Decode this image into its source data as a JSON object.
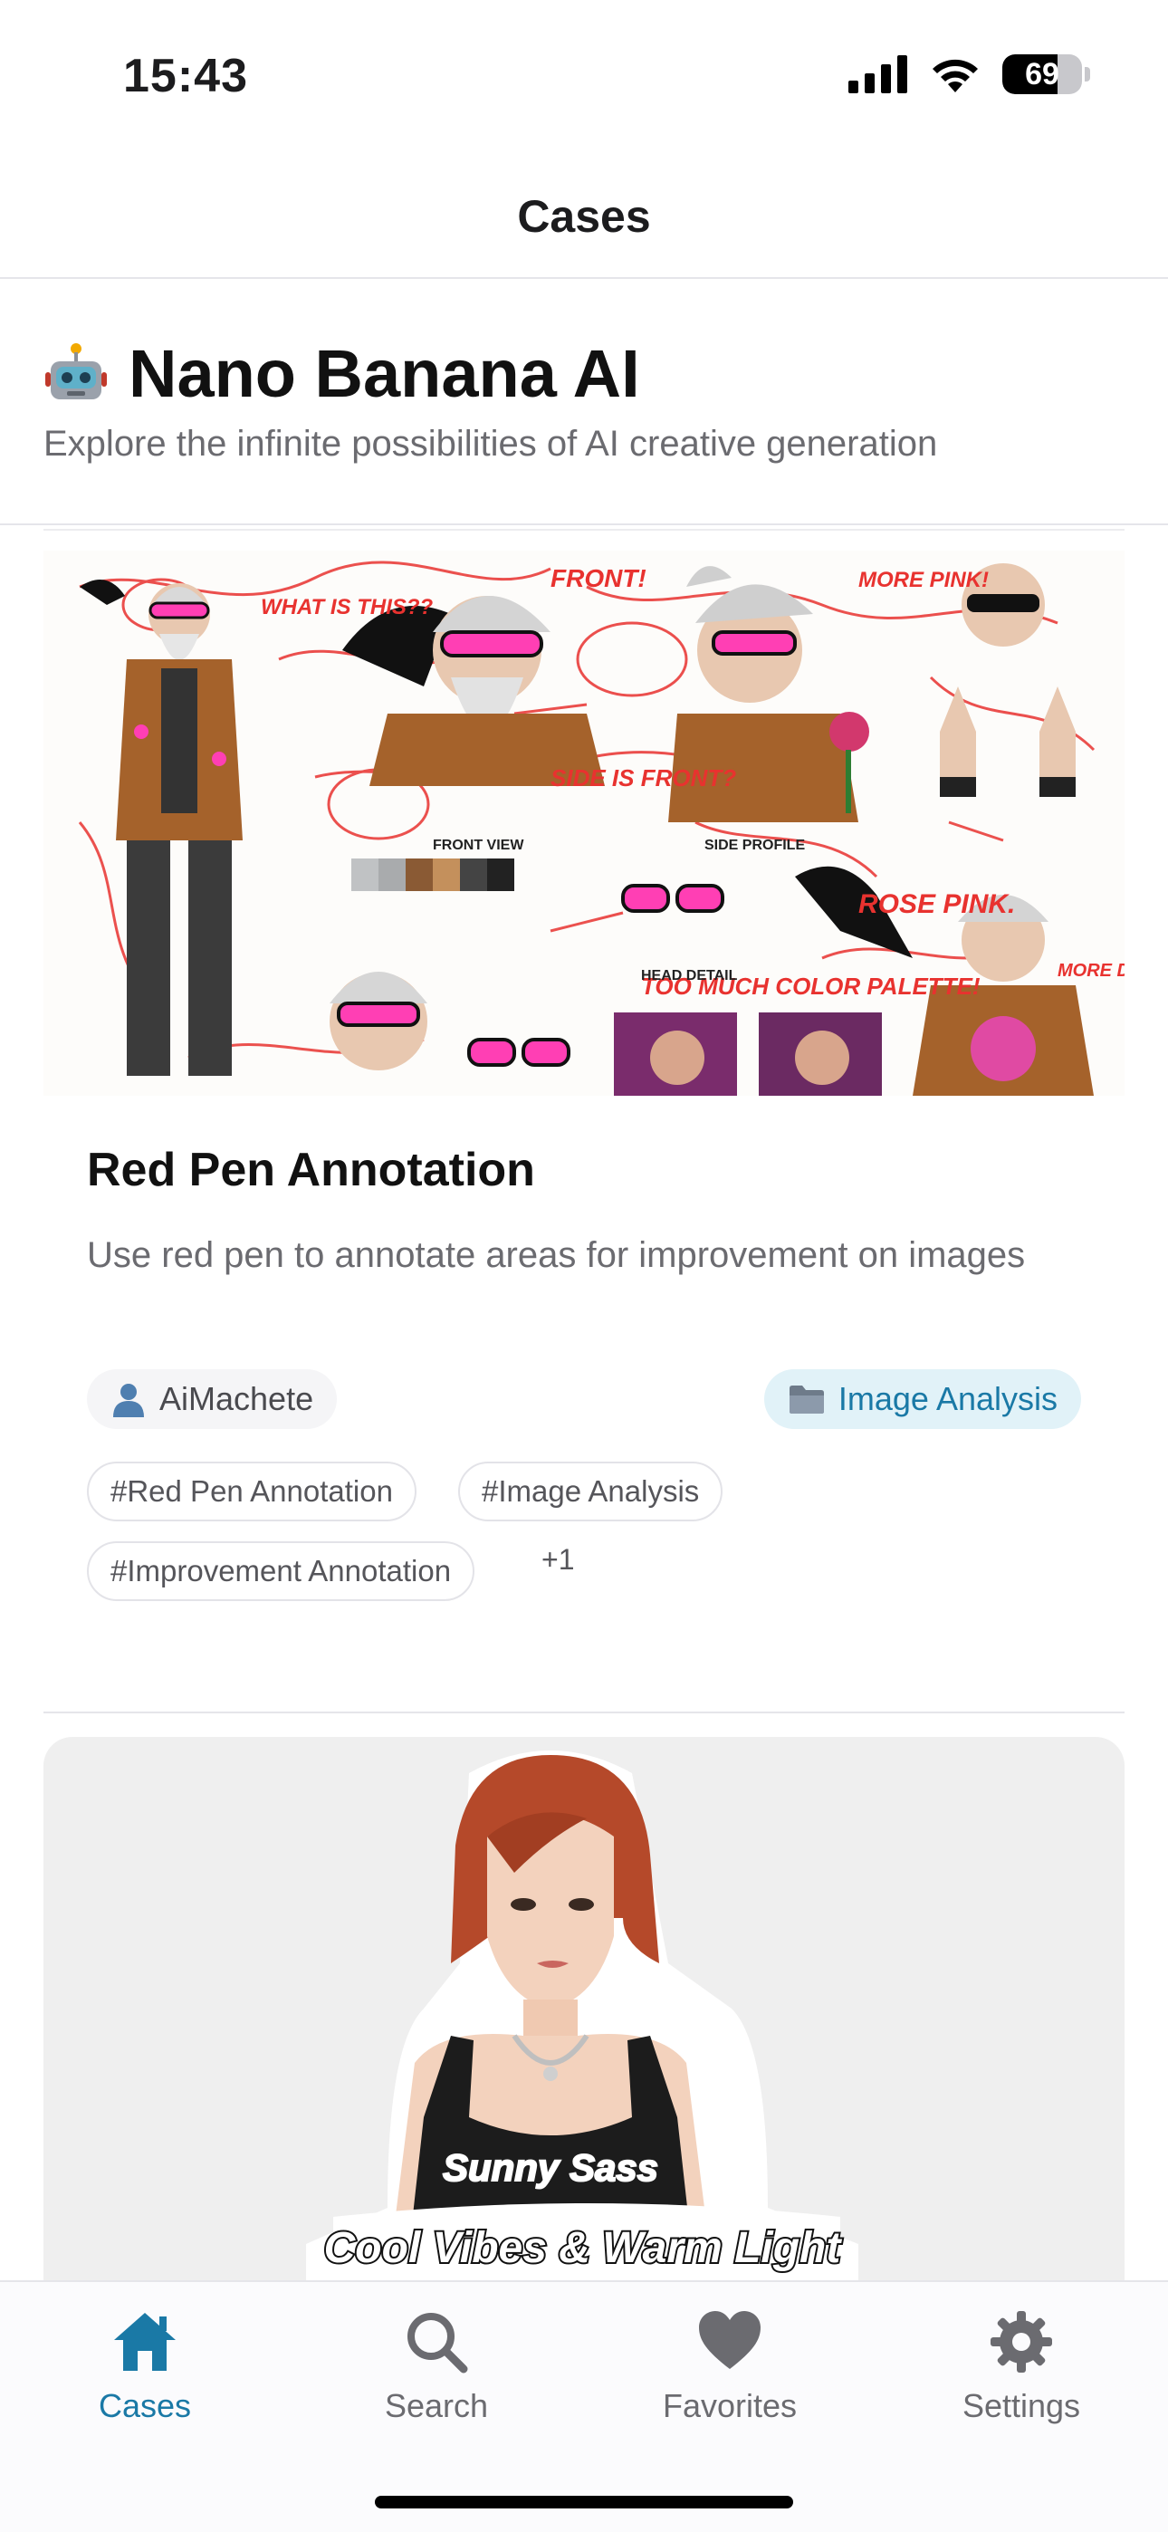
{
  "status_bar": {
    "time": "15:43",
    "battery": "69"
  },
  "nav": {
    "title": "Cases"
  },
  "header": {
    "title": "Nano Banana AI",
    "subtitle": "Explore the infinite possibilities of AI creative generation"
  },
  "card1": {
    "title": "Red Pen Annotation",
    "description": "Use red pen to annotate areas for improvement on images",
    "author": "AiMachete",
    "category": "Image Analysis",
    "tags": [
      "#Red Pen Annotation",
      "#Image Analysis",
      "#Improvement Annotation"
    ],
    "more_tags": "+1",
    "image_notes": [
      "FRONT!",
      "SIDE IS FRONT?",
      "WHAT IS THIS??",
      "MORE PINK!",
      "ROSE PINK.",
      "TOO MUCH COLOR PALETTE!",
      "FRONT VIEW",
      "SIDE PROFILE",
      "HEAD DETAIL",
      "MORE DETAIL!"
    ]
  },
  "card2": {
    "sticker_line1": "Sunny Sass",
    "sticker_line2": "Cool Vibes & Warm Light"
  },
  "tabs": [
    {
      "label": "Cases",
      "icon": "house-icon",
      "active": true
    },
    {
      "label": "Search",
      "icon": "magnifier-icon",
      "active": false
    },
    {
      "label": "Favorites",
      "icon": "heart-icon",
      "active": false
    },
    {
      "label": "Settings",
      "icon": "gear-icon",
      "active": false
    }
  ],
  "colors": {
    "accent": "#1a79a6",
    "annotation_red": "#e8322f",
    "pink": "#ff3fb4"
  }
}
